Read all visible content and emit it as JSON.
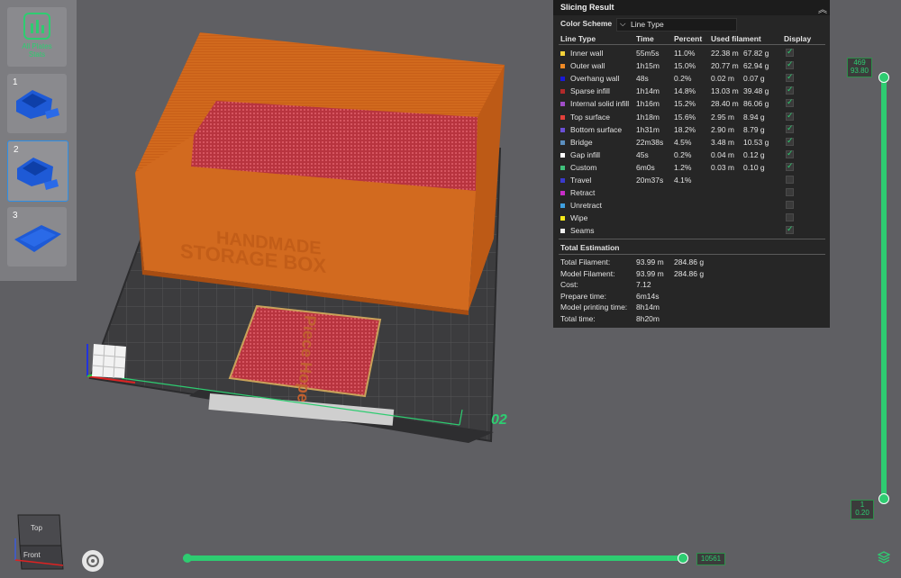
{
  "plates_panel": {
    "stats_label_1": "All Plates",
    "stats_label_2": "Stats",
    "plates": [
      {
        "number": "1"
      },
      {
        "number": "2"
      },
      {
        "number": "3"
      }
    ]
  },
  "slicing_result": {
    "title": "Slicing Result",
    "color_scheme_label": "Color Scheme",
    "color_scheme_value": "Line Type",
    "columns": [
      "Line Type",
      "Time",
      "Percent",
      "Used filament",
      "Display"
    ],
    "rows": [
      {
        "name": "Inner wall",
        "color": "#f4d23a",
        "time": "55m5s",
        "percent": "11.0%",
        "length": "22.38 m",
        "weight": "67.82 g",
        "display": true
      },
      {
        "name": "Outer wall",
        "color": "#f08a25",
        "time": "1h15m",
        "percent": "15.0%",
        "length": "20.77 m",
        "weight": "62.94 g",
        "display": true
      },
      {
        "name": "Overhang wall",
        "color": "#1a1ad6",
        "time": "48s",
        "percent": "0.2%",
        "length": "0.02 m",
        "weight": "0.07 g",
        "display": true
      },
      {
        "name": "Sparse infill",
        "color": "#b22a2a",
        "time": "1h14m",
        "percent": "14.8%",
        "length": "13.03 m",
        "weight": "39.48 g",
        "display": true
      },
      {
        "name": "Internal solid infill",
        "color": "#a04ec8",
        "time": "1h16m",
        "percent": "15.2%",
        "length": "28.40 m",
        "weight": "86.06 g",
        "display": true
      },
      {
        "name": "Top surface",
        "color": "#e4403a",
        "time": "1h18m",
        "percent": "15.6%",
        "length": "2.95 m",
        "weight": "8.94 g",
        "display": true
      },
      {
        "name": "Bottom surface",
        "color": "#6a4fd6",
        "time": "1h31m",
        "percent": "18.2%",
        "length": "2.90 m",
        "weight": "8.79 g",
        "display": true
      },
      {
        "name": "Bridge",
        "color": "#5b8fbf",
        "time": "22m38s",
        "percent": "4.5%",
        "length": "3.48 m",
        "weight": "10.53 g",
        "display": true
      },
      {
        "name": "Gap infill",
        "color": "#ffffff",
        "time": "45s",
        "percent": "0.2%",
        "length": "0.04 m",
        "weight": "0.12 g",
        "display": true
      },
      {
        "name": "Custom",
        "color": "#3fc07a",
        "time": "6m0s",
        "percent": "1.2%",
        "length": "0.03 m",
        "weight": "0.10 g",
        "display": true
      },
      {
        "name": "Travel",
        "color": "#3a3acc",
        "time": "20m37s",
        "percent": "4.1%",
        "length": "",
        "weight": "",
        "display": false
      },
      {
        "name": "Retract",
        "color": "#c82ec8",
        "time": "",
        "percent": "",
        "length": "",
        "weight": "",
        "display": false
      },
      {
        "name": "Unretract",
        "color": "#3fa0e0",
        "time": "",
        "percent": "",
        "length": "",
        "weight": "",
        "display": false
      },
      {
        "name": "Wipe",
        "color": "#f4e81a",
        "time": "",
        "percent": "",
        "length": "",
        "weight": "",
        "display": false
      },
      {
        "name": "Seams",
        "color": "#eeeeee",
        "time": "",
        "percent": "",
        "length": "",
        "weight": "",
        "display": true
      }
    ],
    "estimation_title": "Total Estimation",
    "estimation": [
      {
        "label": "Total Filament:",
        "value1": "93.99 m",
        "value2": "284.86 g"
      },
      {
        "label": "Model Filament:",
        "value1": "93.99 m",
        "value2": "284.86 g"
      },
      {
        "label": "Cost:",
        "value1": "7.12",
        "value2": ""
      },
      {
        "label": "Prepare time:",
        "value1": "6m14s",
        "value2": ""
      },
      {
        "label": "Model printing time:",
        "value1": "8h14m",
        "value2": ""
      },
      {
        "label": "Total time:",
        "value1": "8h20m",
        "value2": ""
      }
    ]
  },
  "plate_label": "02",
  "layer_slider": {
    "top_value": "469",
    "top_height": "93.80",
    "bottom_value": "1",
    "bottom_height": "0.20"
  },
  "move_slider": {
    "value": "10561"
  },
  "view_cube": {
    "top": "Top",
    "front": "Front"
  },
  "colors": {
    "accent": "#2ecc71",
    "panel": "#262626",
    "model": "#d2691e"
  }
}
